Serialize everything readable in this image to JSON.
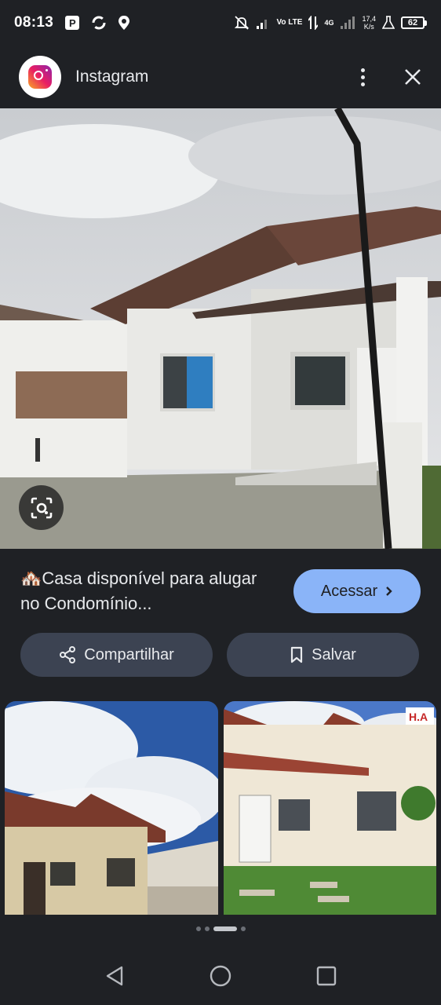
{
  "status_bar": {
    "time": "08:13",
    "network": "Vo LTE",
    "net_type": "4G",
    "speed_value": "17,4",
    "speed_unit": "K/s",
    "battery": "62"
  },
  "app_bar": {
    "title": "Instagram"
  },
  "result": {
    "caption_emoji": "🏘️",
    "caption": "Casa disponível para alugar no Condomínio...",
    "visit_label": "Acessar",
    "share_label": "Compartilhar",
    "save_label": "Salvar"
  },
  "thumbs": [
    {
      "description": "house-photo-1"
    },
    {
      "description": "house-photo-2",
      "badge": "H.A"
    }
  ],
  "colors": {
    "background": "#1f2125",
    "accent": "#8ab4f8",
    "pill": "#3c4352"
  }
}
